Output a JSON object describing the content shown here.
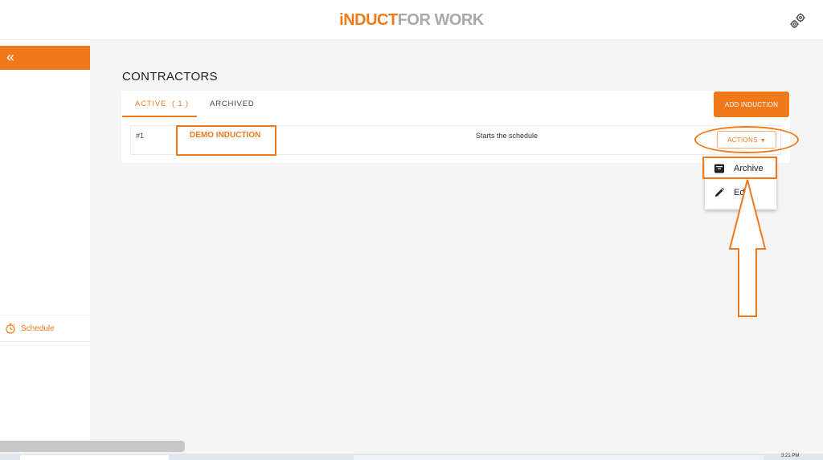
{
  "header": {
    "logo_part1": "iNDUCT",
    "logo_part2": "FOR WORK",
    "settings_icon": "gears-icon"
  },
  "sidebar": {
    "collapse_label": "«",
    "items": [
      {
        "label": "Schedule",
        "icon": "stopwatch-icon"
      }
    ]
  },
  "page": {
    "title": "CONTRACTORS",
    "tabs": [
      {
        "label": "ACTIVE  ( 1 )",
        "active": true
      },
      {
        "label": "ARCHIVED",
        "active": false
      }
    ],
    "add_button": "ADD INDUCTION"
  },
  "table": {
    "rows": [
      {
        "num": "#1",
        "name": "DEMO INDUCTION",
        "description": "Starts the schedule"
      }
    ]
  },
  "actions": {
    "button_label": "ACTIONS",
    "menu": [
      {
        "label": "Archive",
        "icon": "archive-box-icon"
      },
      {
        "label": "Edit",
        "icon": "pencil-icon"
      }
    ]
  },
  "taskbar": {
    "time": "3:21 PM"
  },
  "colors": {
    "accent": "#f07a1a",
    "logo_gray": "#a9a9a9",
    "background": "#f5f5f5"
  }
}
